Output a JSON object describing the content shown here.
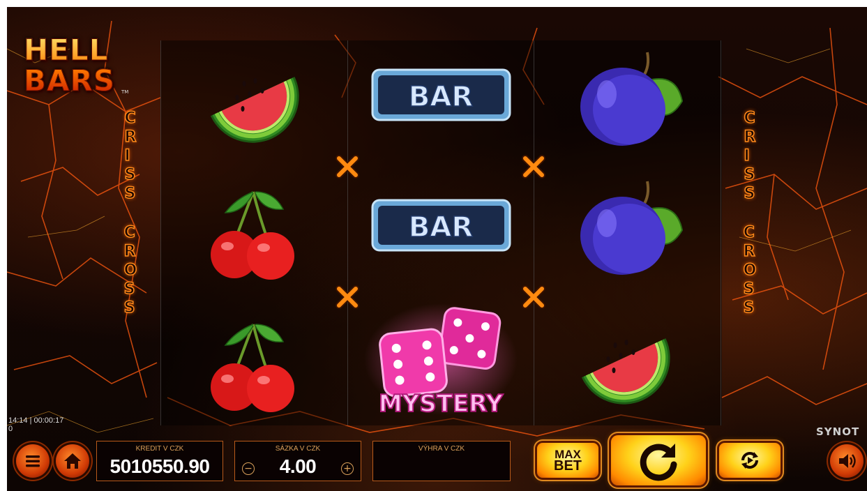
{
  "game": {
    "logo_line1": "HELL",
    "logo_line2": "BARS",
    "logo_tm": "TM",
    "side_text_word1": "CRISS",
    "side_text_word2": "CROSS",
    "provider": "SYNOT"
  },
  "reels": [
    [
      "watermelon",
      "cherries",
      "cherries"
    ],
    [
      "bar",
      "bar",
      "mystery-dice"
    ],
    [
      "plum",
      "plum",
      "watermelon"
    ]
  ],
  "symbols": {
    "bar_label": "BAR",
    "mystery_label": "MYSTERY"
  },
  "status": {
    "clock": "14:14 | 00:00:17",
    "counter": "0"
  },
  "panels": {
    "credit_label": "KREDIT V CZK",
    "credit_value": "5010550.90",
    "bet_label": "SÁZKA V CZK",
    "bet_value": "4.00",
    "win_label": "VÝHRA V CZK",
    "win_value": ""
  },
  "controls": {
    "max_bet_line1": "MAX",
    "max_bet_line2": "BET",
    "icons": [
      "menu-icon",
      "home-icon",
      "minus-icon",
      "plus-icon",
      "spin-icon",
      "autoplay-icon",
      "sound-icon"
    ]
  },
  "colors": {
    "accent_orange": "#ff7a00",
    "gold": "#ffd21a",
    "panel_border": "#b85a1a",
    "panel_label": "#d9a05a"
  }
}
